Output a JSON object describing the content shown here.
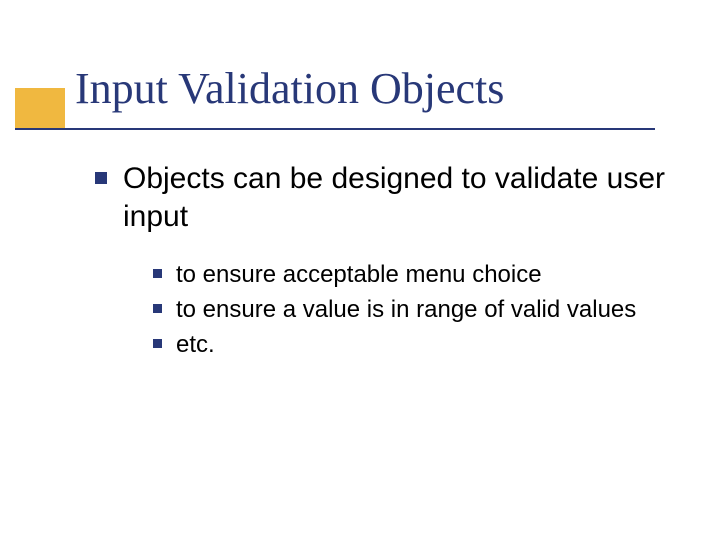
{
  "slide": {
    "title": "Input Validation Objects",
    "bullets": [
      {
        "text": "Objects can be designed to validate user input",
        "sub": [
          {
            "text": "to ensure acceptable menu choice"
          },
          {
            "text": "to ensure a value is in range of valid values"
          },
          {
            "text": "etc."
          }
        ]
      }
    ]
  }
}
